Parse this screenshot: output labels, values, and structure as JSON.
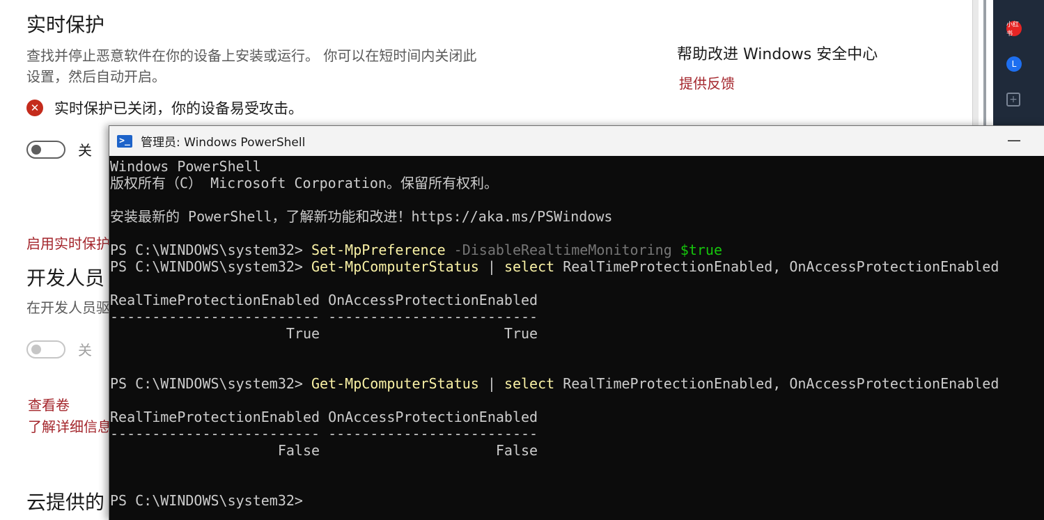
{
  "security": {
    "realtime": {
      "title": "实时保护",
      "desc_line1": "查找并停止恶意软件在你的设备上安装或运行。 你可以在短时间内关闭此",
      "desc_line2": "设置，然后自动开启。",
      "alert": "实时保护已关闭，你的设备易受攻击。",
      "toggle_label": "关",
      "link": "启用实时保护"
    },
    "developer": {
      "title": "开发人员",
      "desc": "在开发人员驱",
      "toggle_label": "关",
      "link1": "查看卷",
      "link2": "了解详细信息"
    },
    "cloud": {
      "title": "云提供的"
    },
    "side": {
      "title": "帮助改进 Windows 安全中心",
      "feedback": "提供反馈"
    }
  },
  "sidebar": {
    "red_app": "小红书",
    "blue_app": "L",
    "add": "+"
  },
  "powershell": {
    "title": "管理员: Windows PowerShell",
    "icon": ">_",
    "minimize": "—",
    "lines": {
      "l1": "Windows PowerShell",
      "l2": "版权所有（C） Microsoft Corporation。保留所有权利。",
      "l3": "",
      "l4": "安装最新的 PowerShell，了解新功能和改进！https://aka.ms/PSWindows",
      "l5": ""
    },
    "prompt": "PS C:\\WINDOWS\\system32> ",
    "cmd1": {
      "cmdlet": "Set-MpPreference",
      "param": " -DisableRealtimeMonitoring ",
      "value": "$true"
    },
    "cmd2": {
      "cmdlet": "Get-MpComputerStatus",
      "pipe": " | ",
      "select": "select",
      "rest": " RealTimeProtectionEnabled, OnAccessProtectionEnabled"
    },
    "header": "RealTimeProtectionEnabled OnAccessProtectionEnabled",
    "underline": "------------------------- -------------------------",
    "row1": "                     True                      True",
    "row2": "                    False                     False"
  }
}
